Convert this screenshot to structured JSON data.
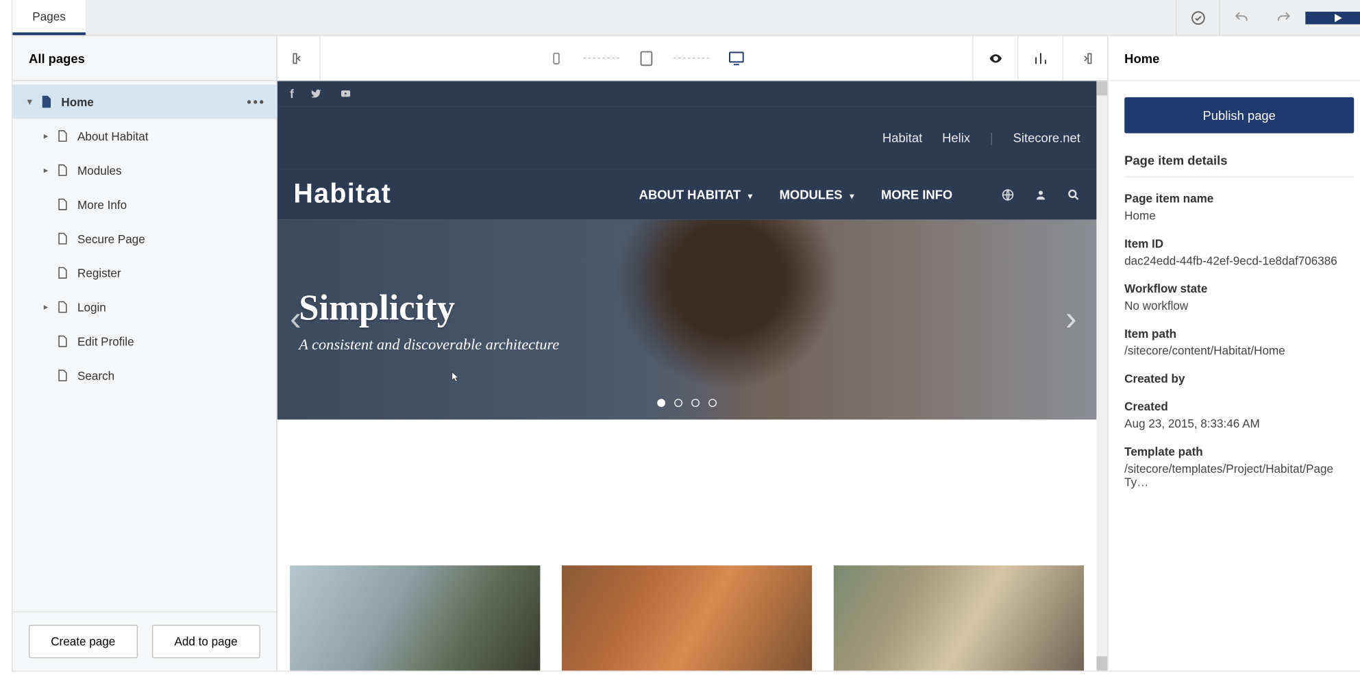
{
  "topbar": {
    "tab_label": "Pages"
  },
  "sidebar": {
    "header": "All pages",
    "home_label": "Home",
    "items": [
      {
        "label": "About Habitat",
        "expandable": true
      },
      {
        "label": "Modules",
        "expandable": true
      },
      {
        "label": "More Info",
        "expandable": false
      },
      {
        "label": "Secure Page",
        "expandable": false
      },
      {
        "label": "Register",
        "expandable": false
      },
      {
        "label": "Login",
        "expandable": true
      },
      {
        "label": "Edit Profile",
        "expandable": false
      },
      {
        "label": "Search",
        "expandable": false
      }
    ],
    "create_btn": "Create page",
    "add_btn": "Add to page"
  },
  "preview": {
    "top_links": [
      "Habitat",
      "Helix",
      "Sitecore.net"
    ],
    "logo": "Habitat",
    "nav": [
      "ABOUT HABITAT",
      "MODULES",
      "MORE INFO"
    ],
    "hero_title": "Simplicity",
    "hero_subtitle": "A consistent and discoverable architecture",
    "hero_dots": 4,
    "hero_active_dot": 0
  },
  "rightpanel": {
    "header": "Home",
    "publish_btn": "Publish page",
    "section_title": "Page item details",
    "fields": {
      "name_label": "Page item name",
      "name_value": "Home",
      "id_label": "Item ID",
      "id_value": "dac24edd-44fb-42ef-9ecd-1e8daf706386",
      "workflow_label": "Workflow state",
      "workflow_value": "No workflow",
      "path_label": "Item path",
      "path_value": "/sitecore/content/Habitat/Home",
      "createdby_label": "Created by",
      "createdby_value": "",
      "created_label": "Created",
      "created_value": "Aug 23, 2015, 8:33:46 AM",
      "template_label": "Template path",
      "template_value": "/sitecore/templates/Project/Habitat/Page Ty…"
    }
  }
}
